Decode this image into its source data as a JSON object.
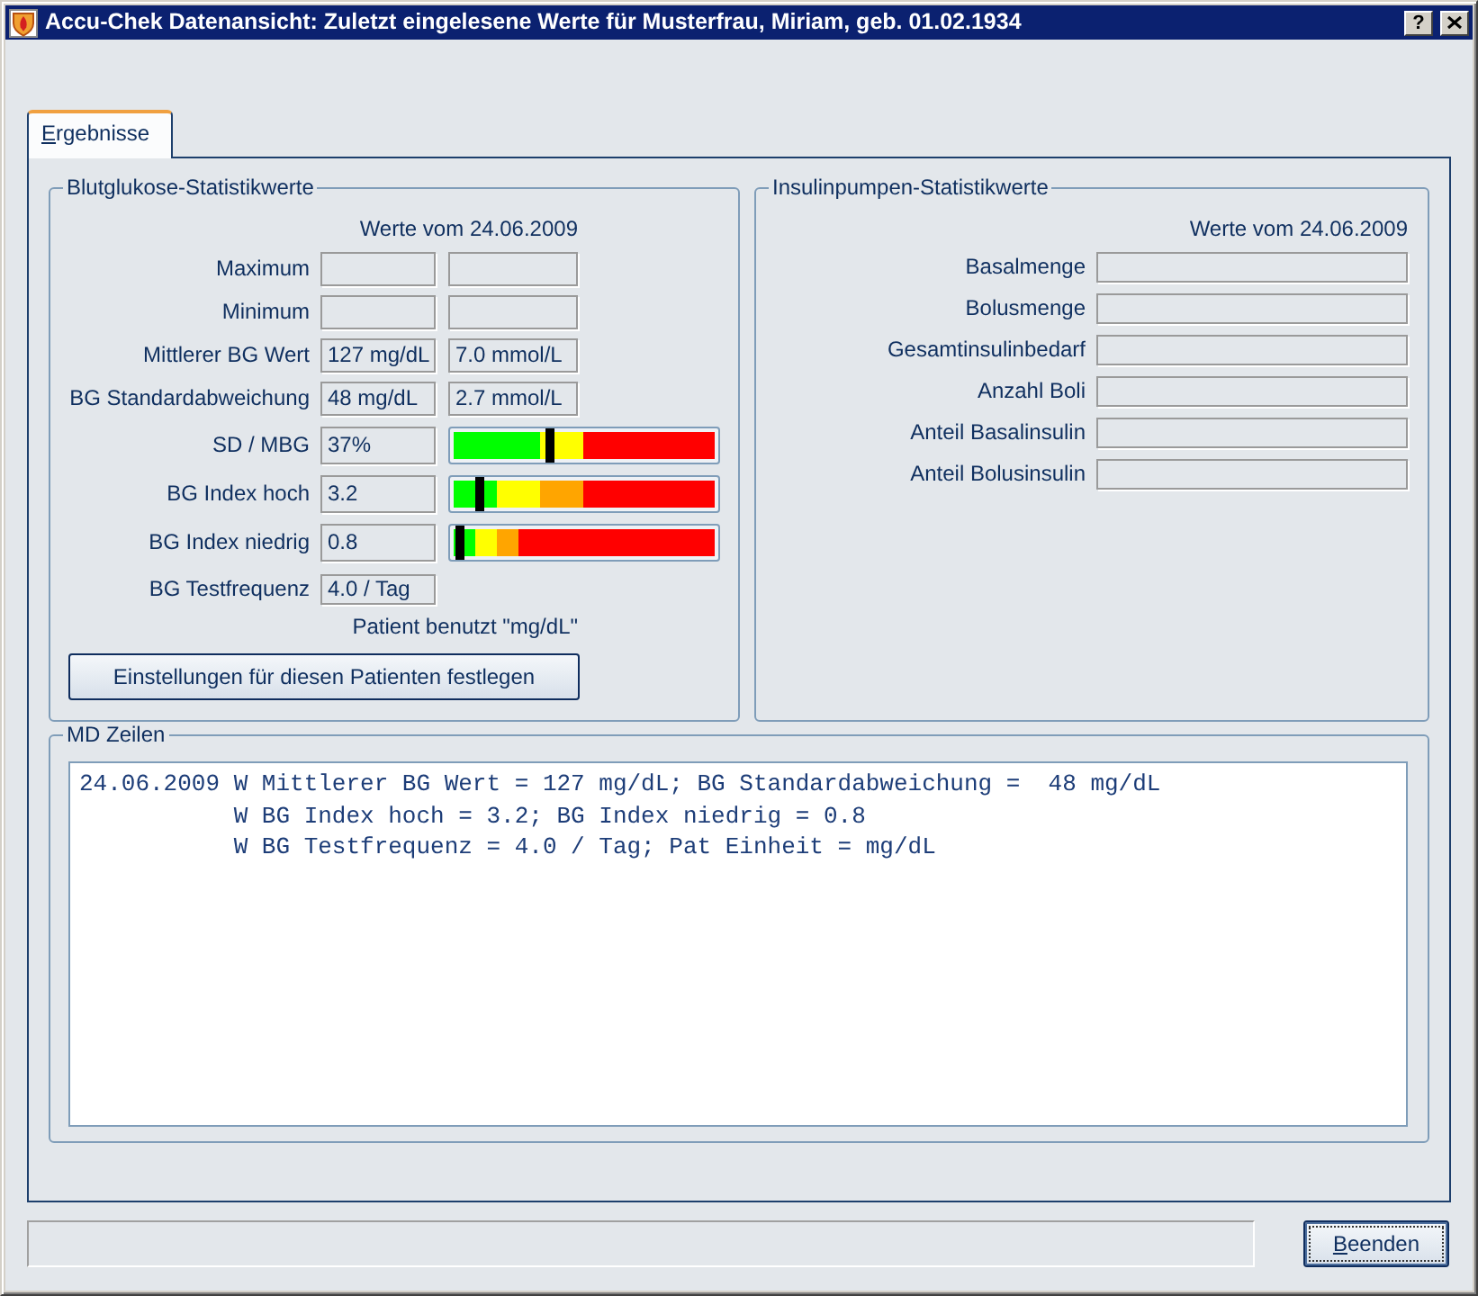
{
  "window": {
    "title": "Accu-Chek Datenansicht: Zuletzt eingelesene Werte für Musterfrau, Miriam, geb. 01.02.1934",
    "help_button": "?"
  },
  "tabs": [
    {
      "label": "Ergebnisse",
      "selected": true
    }
  ],
  "bg_stats": {
    "title": "Blutglukose-Statistikwerte",
    "date_caption": "Werte vom 24.06.2009",
    "rows": [
      {
        "label": "Maximum",
        "kind": "pair"
      },
      {
        "label": "Minimum",
        "kind": "pair"
      },
      {
        "label": "Mittlerer BG Wert",
        "kind": "pair",
        "values": [
          "127 mg/dL",
          "7.0 mmol/L"
        ]
      },
      {
        "label": "BG Standardabweichung",
        "kind": "pair",
        "values": [
          "48 mg/dL",
          "2.7 mmol/L"
        ]
      },
      {
        "label": "SD / MBG",
        "kind": "gauge",
        "values": [
          "37%"
        ],
        "gauge": {
          "kind": "variability",
          "level": 0.37
        }
      },
      {
        "label": "BG Index hoch",
        "kind": "gauge",
        "values": [
          "3.2"
        ],
        "gauge": {
          "kind": "high",
          "level": 0.103
        }
      },
      {
        "label": "BG Index niedrig",
        "kind": "gauge",
        "values": [
          "0.8"
        ],
        "gauge": {
          "kind": "low",
          "level": 0.024
        }
      },
      {
        "label": "BG Testfrequenz",
        "kind": "single",
        "values": [
          "4.0 / Tag"
        ]
      }
    ],
    "unit_note": "Patient benutzt \"mg/dL\"",
    "settings_button": "Einstellungen für diesen Patienten festlegen"
  },
  "pump_stats": {
    "title": "Insulinpumpen-Statistikwerte",
    "date_caption": "Werte vom 24.06.2009",
    "rows": [
      {
        "label": "Basalmenge"
      },
      {
        "label": "Bolusmenge"
      },
      {
        "label": "Gesamtinsulinbedarf"
      },
      {
        "label": "Anzahl Boli"
      },
      {
        "label": "Anteil Basalinsulin"
      },
      {
        "label": "Anteil Bolusinsulin"
      }
    ]
  },
  "md_lines": {
    "title": "MD Zeilen",
    "lines": [
      "24.06.2009 W Mittlerer BG Wert = 127 mg/dL; BG Standardabweichung =  48 mg/dL",
      "           W BG Index hoch = 3.2; BG Index niedrig = 0.8",
      "           W BG Testfrequenz = 4.0 / Tag; Pat Einheit = mg/dL"
    ]
  },
  "buttons": [
    {
      "label": "Beenden",
      "default": true
    }
  ]
}
